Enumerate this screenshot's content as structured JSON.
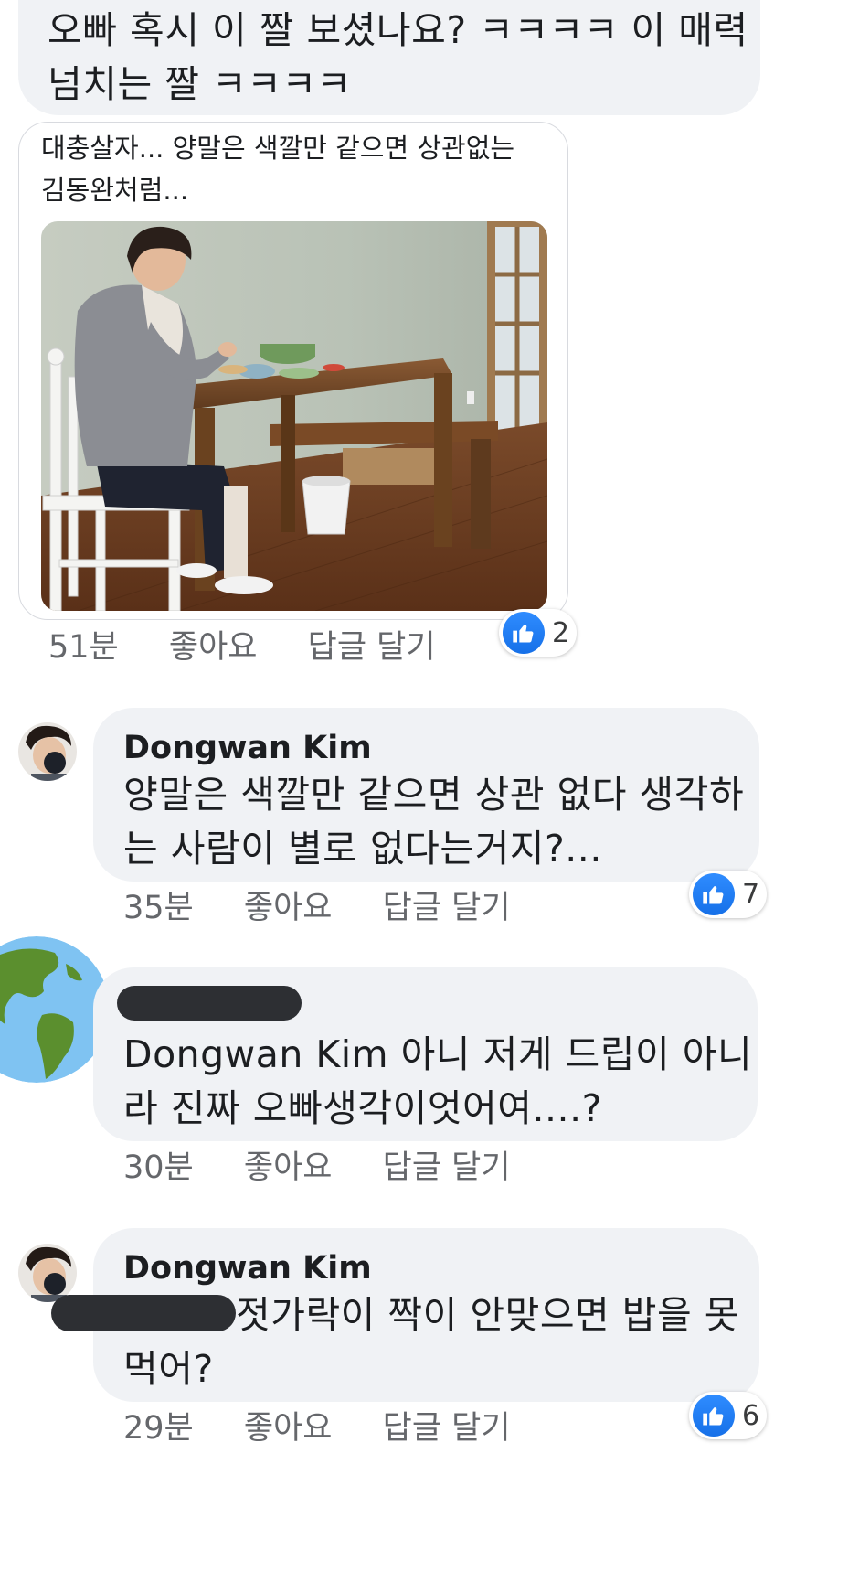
{
  "comments": [
    {
      "text_line1": "오빠 혹시 이 짤 보셨나요? ㅋㅋㅋㅋ 이 매력",
      "text_line2": "넘치는 짤 ㅋㅋㅋㅋ"
    },
    {
      "shared_post_text_line1": "대충살자... 양말은 색깔만 같으면 상관없는",
      "shared_post_text_line2": "김동완처럼...",
      "time": "51분",
      "like_label": "좋아요",
      "reply_label": "답글 달기",
      "reaction_count": "2"
    },
    {
      "author": "Dongwan Kim",
      "text_line1": "양말은 색깔만 같으면 상관 없다 생각하",
      "text_line2": "는 사람이 별로 없다는거지?...",
      "time": "35분",
      "like_label": "좋아요",
      "reply_label": "답글 달기",
      "reaction_count": "7"
    },
    {
      "text_line1": "Dongwan Kim 아니 저게 드립이 아니",
      "text_line2": "라 진짜 오빠생각이엇어여....?",
      "time": "30분",
      "like_label": "좋아요",
      "reply_label": "답글 달기"
    },
    {
      "author": "Dongwan Kim",
      "text_line1": "젓가락이 짝이 안맞으면 밥을 못",
      "text_line2": "먹어?",
      "time": "29분",
      "like_label": "좋아요",
      "reply_label": "답글 달기",
      "reaction_count": "6"
    }
  ],
  "colors": {
    "bubble": "#f0f2f5",
    "like_blue": "#1877f2",
    "meta_gray": "#65676b",
    "redaction": "#2d2f33"
  },
  "icons": {
    "reaction": "thumbs-up-icon",
    "globe_avatar": "globe-avatar",
    "profile_avatar": "profile-photo-avatar"
  }
}
